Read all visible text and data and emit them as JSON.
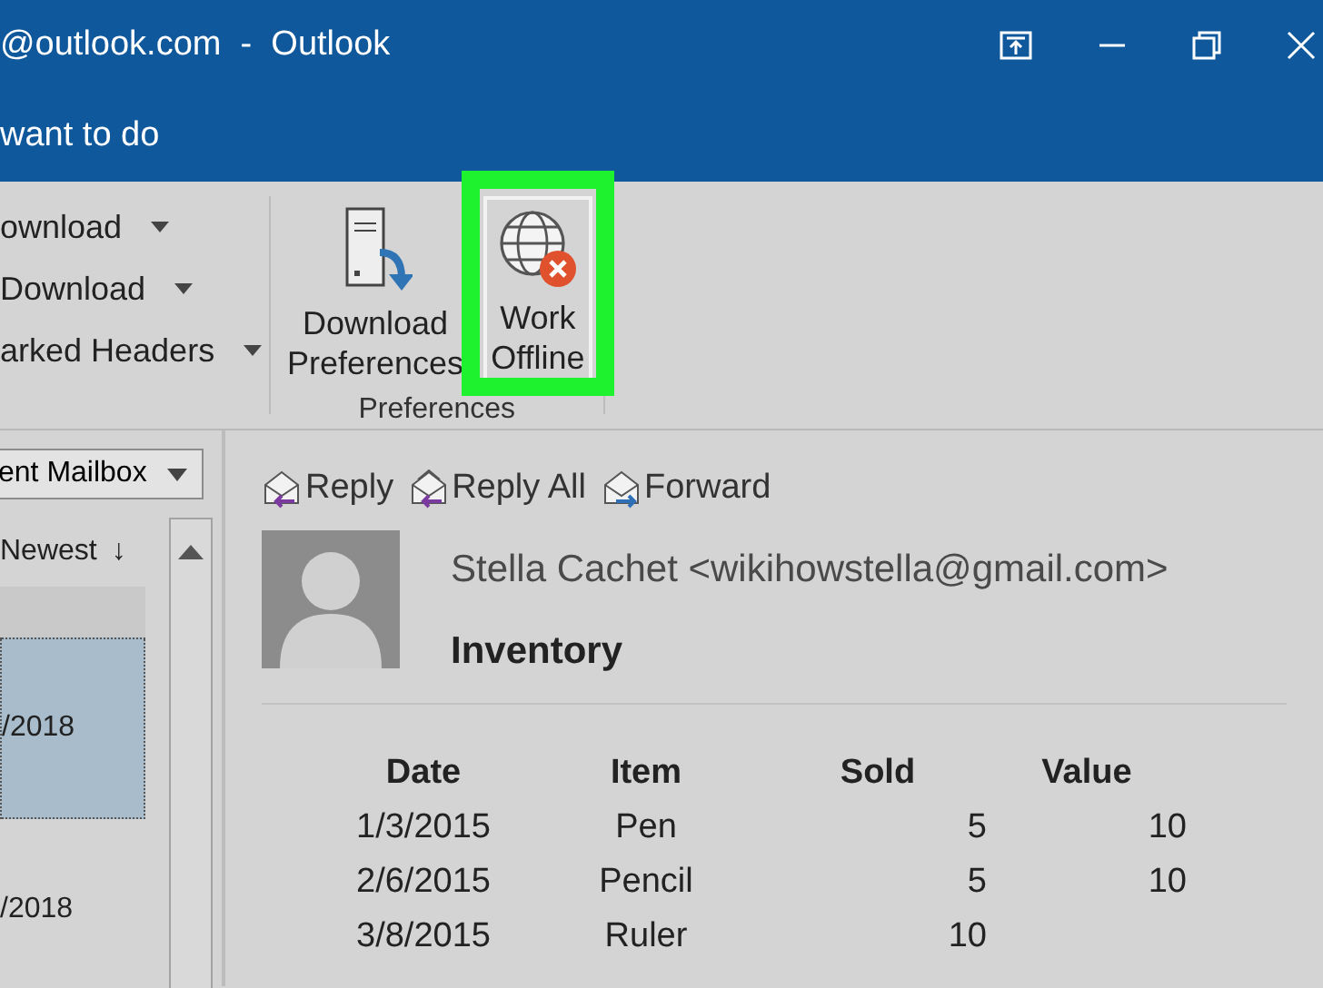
{
  "window": {
    "title": "@outlook.com  -  Outlook",
    "tell_me": "want to do"
  },
  "ribbon": {
    "download_commands": [
      {
        "label": "ownload"
      },
      {
        "label": "Download"
      },
      {
        "label": "arked Headers"
      }
    ],
    "preferences_group": {
      "label": "Preferences",
      "buttons": [
        {
          "label": "Download Preferences",
          "kind": "server",
          "highlighted": false
        },
        {
          "label": "Work Offline",
          "kind": "offline",
          "highlighted": true
        }
      ]
    }
  },
  "mail_list": {
    "mailbox": "ent Mailbox",
    "sort": "Newest",
    "sort_arrow": "↓",
    "items": [
      {
        "date": "/2018",
        "selected": true
      },
      {
        "date": "/2018",
        "selected": false
      }
    ]
  },
  "reading_pane": {
    "actions": [
      {
        "label": "Reply",
        "kind": "reply"
      },
      {
        "label": "Reply All",
        "kind": "reply_all"
      },
      {
        "label": "Forward",
        "kind": "forward"
      }
    ],
    "sender": "Stella Cachet <wikihowstella@gmail.com>",
    "subject": "Inventory",
    "table": {
      "columns": [
        "Date",
        "Item",
        "Sold",
        "Value"
      ],
      "rows": [
        [
          "1/3/2015",
          "Pen",
          "5",
          "10"
        ],
        [
          "2/6/2015",
          "Pencil",
          "5",
          "10"
        ],
        [
          "3/8/2015",
          "Ruler",
          "10"
        ]
      ]
    }
  }
}
